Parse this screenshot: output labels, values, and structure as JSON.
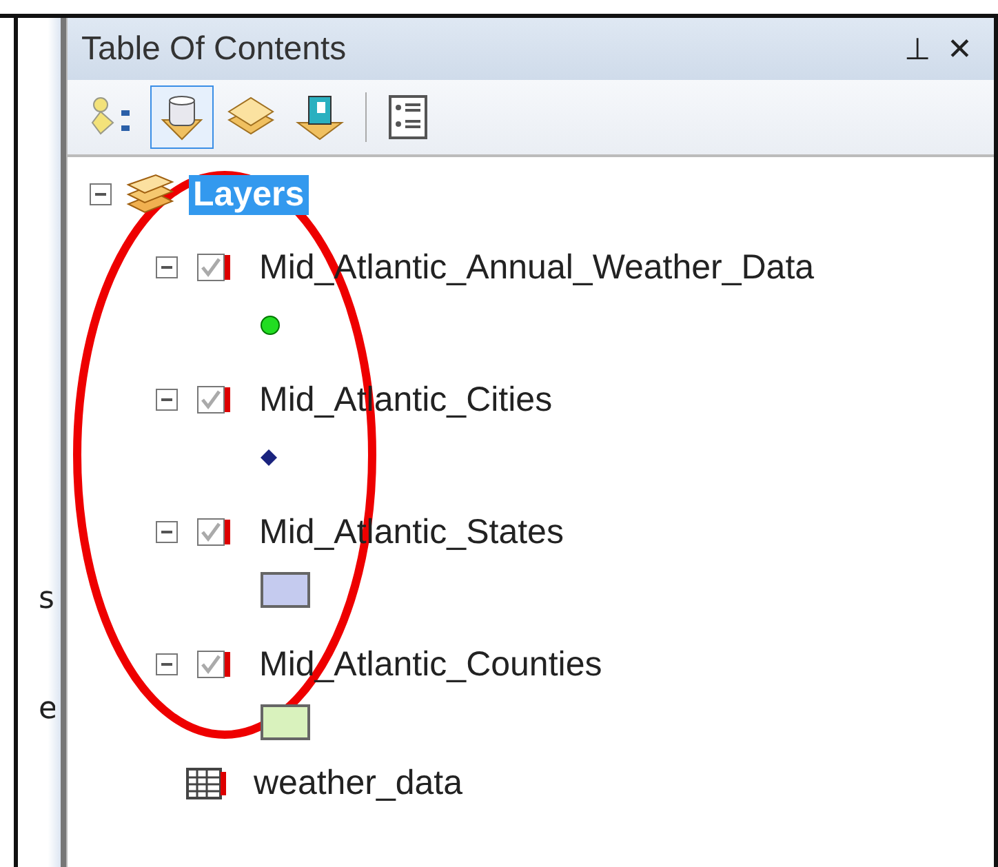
{
  "left_strip": {
    "letters": [
      "s",
      "e"
    ]
  },
  "panel": {
    "title": "Table Of Contents",
    "pin": "⊥",
    "close": "✕"
  },
  "toolbar": {
    "buttons": [
      {
        "kind": "drawing_order",
        "selected": false
      },
      {
        "kind": "source",
        "selected": true
      },
      {
        "kind": "visibility",
        "selected": false
      },
      {
        "kind": "selection",
        "selected": false
      },
      {
        "kind": "options",
        "selected": false
      }
    ]
  },
  "tree": {
    "label": "Layers",
    "expanded": true,
    "selected": true,
    "children": [
      {
        "kind": "layer",
        "name": "Mid_Atlantic_Annual_Weather_Data",
        "expanded": true,
        "checked": true,
        "symbol": {
          "kind": "circle",
          "color": "#22dd22"
        }
      },
      {
        "kind": "layer",
        "name": "Mid_Atlantic_Cities",
        "expanded": true,
        "checked": true,
        "symbol": {
          "kind": "diamond",
          "color": "#1a237e"
        }
      },
      {
        "kind": "layer",
        "name": "Mid_Atlantic_States",
        "expanded": true,
        "checked": true,
        "symbol": {
          "kind": "polygon",
          "color": "#c5cbef"
        }
      },
      {
        "kind": "layer",
        "name": "Mid_Atlantic_Counties",
        "expanded": true,
        "checked": true,
        "symbol": {
          "kind": "polygon",
          "color": "#d9f2bd"
        }
      },
      {
        "kind": "table",
        "name": "weather_data"
      }
    ]
  },
  "annotation": {
    "kind": "ellipse",
    "color": "#ee0000"
  }
}
